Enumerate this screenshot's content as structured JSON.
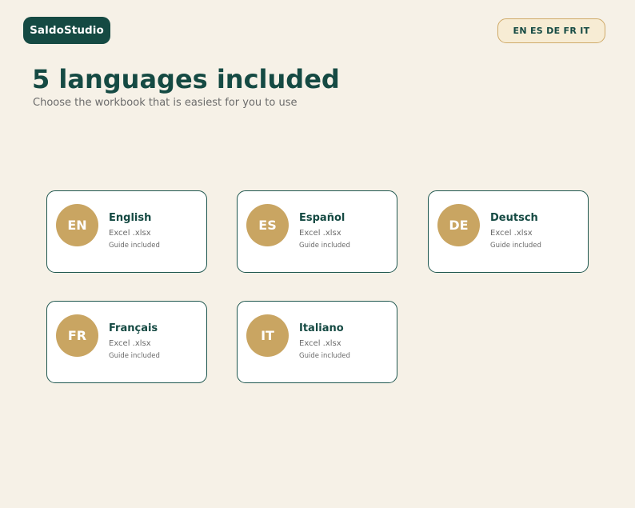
{
  "header": {
    "brand": "SaldoStudio",
    "language_switch": "EN ES DE FR IT"
  },
  "main": {
    "title": "5 languages included",
    "subtitle": "Choose the workbook that is easiest for you to use"
  },
  "languages": [
    {
      "code": "EN",
      "name": "English",
      "file": "Excel .xlsx",
      "note": "Guide included"
    },
    {
      "code": "ES",
      "name": "Español",
      "file": "Excel .xlsx",
      "note": "Guide included"
    },
    {
      "code": "DE",
      "name": "Deutsch",
      "file": "Excel .xlsx",
      "note": "Guide included"
    },
    {
      "code": "FR",
      "name": "Français",
      "file": "Excel .xlsx",
      "note": "Guide included"
    },
    {
      "code": "IT",
      "name": "Italiano",
      "file": "Excel .xlsx",
      "note": "Guide included"
    }
  ],
  "colors": {
    "brand": "#154a43",
    "accent": "#c9a562",
    "background": "#f6f1e7"
  }
}
